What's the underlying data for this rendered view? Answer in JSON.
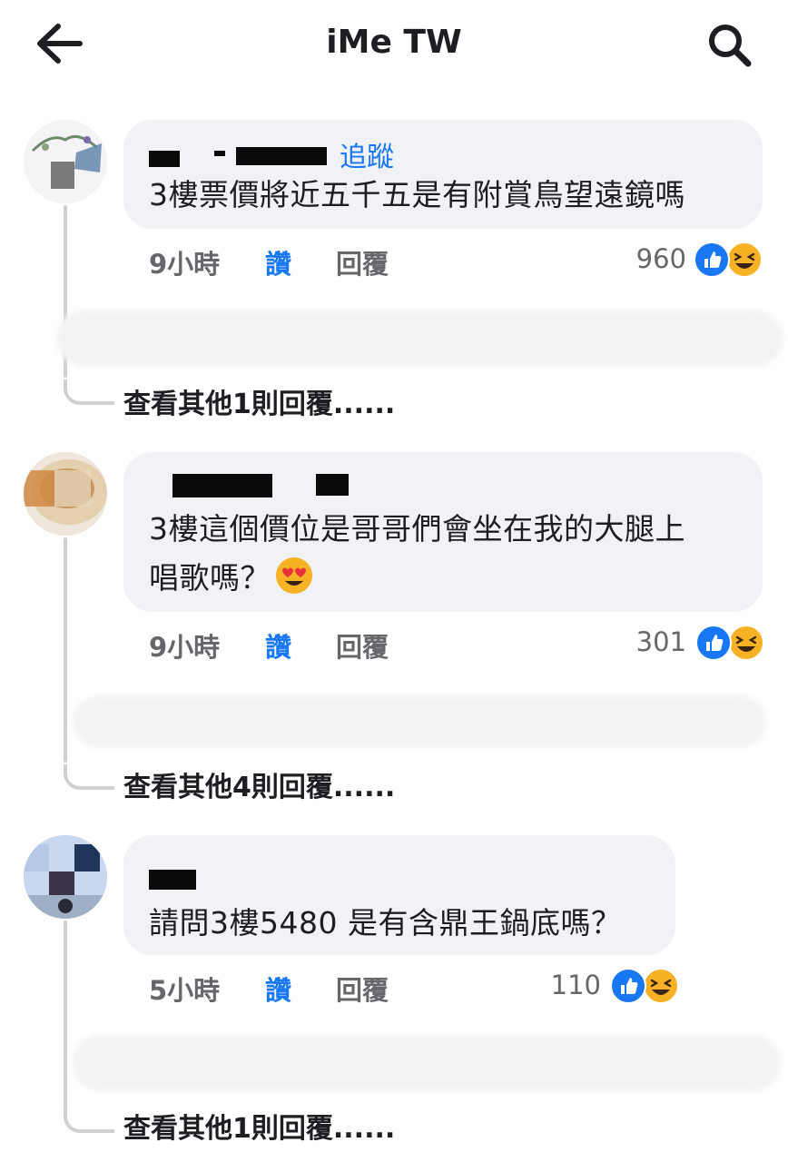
{
  "header": {
    "title": "iMe TW",
    "back_icon": "back-arrow-icon",
    "search_icon": "search-icon"
  },
  "comments": [
    {
      "follow": "追蹤",
      "text": "3樓票價將近五千五是有附賞鳥望遠鏡嗎",
      "time": "9小時",
      "like": "讚",
      "reply": "回覆",
      "reaction_count": "960",
      "reactions": [
        "like-icon",
        "haha-icon"
      ],
      "more_replies": "查看其他1則回覆......"
    },
    {
      "text_line1": "3樓這個價位是哥哥們會坐在我的大腿上",
      "text_line2": "唱歌嗎？",
      "emoji": "heart-eyes-emoji",
      "time": "9小時",
      "like": "讚",
      "reply": "回覆",
      "reaction_count": "301",
      "reactions": [
        "like-icon",
        "haha-icon"
      ],
      "more_replies": "查看其他4則回覆......"
    },
    {
      "text": "請問3樓5480 是有含鼎王鍋底嗎？",
      "time": "5小時",
      "like": "讚",
      "reply": "回覆",
      "reaction_count": "110",
      "reactions": [
        "like-icon",
        "haha-icon"
      ],
      "more_replies": "查看其他1則回覆......"
    }
  ],
  "colors": {
    "link_blue": "#1877f2",
    "bubble_bg": "#f0f2f5",
    "meta_gray": "#65676b",
    "haha_yellow": "#f7b125"
  }
}
